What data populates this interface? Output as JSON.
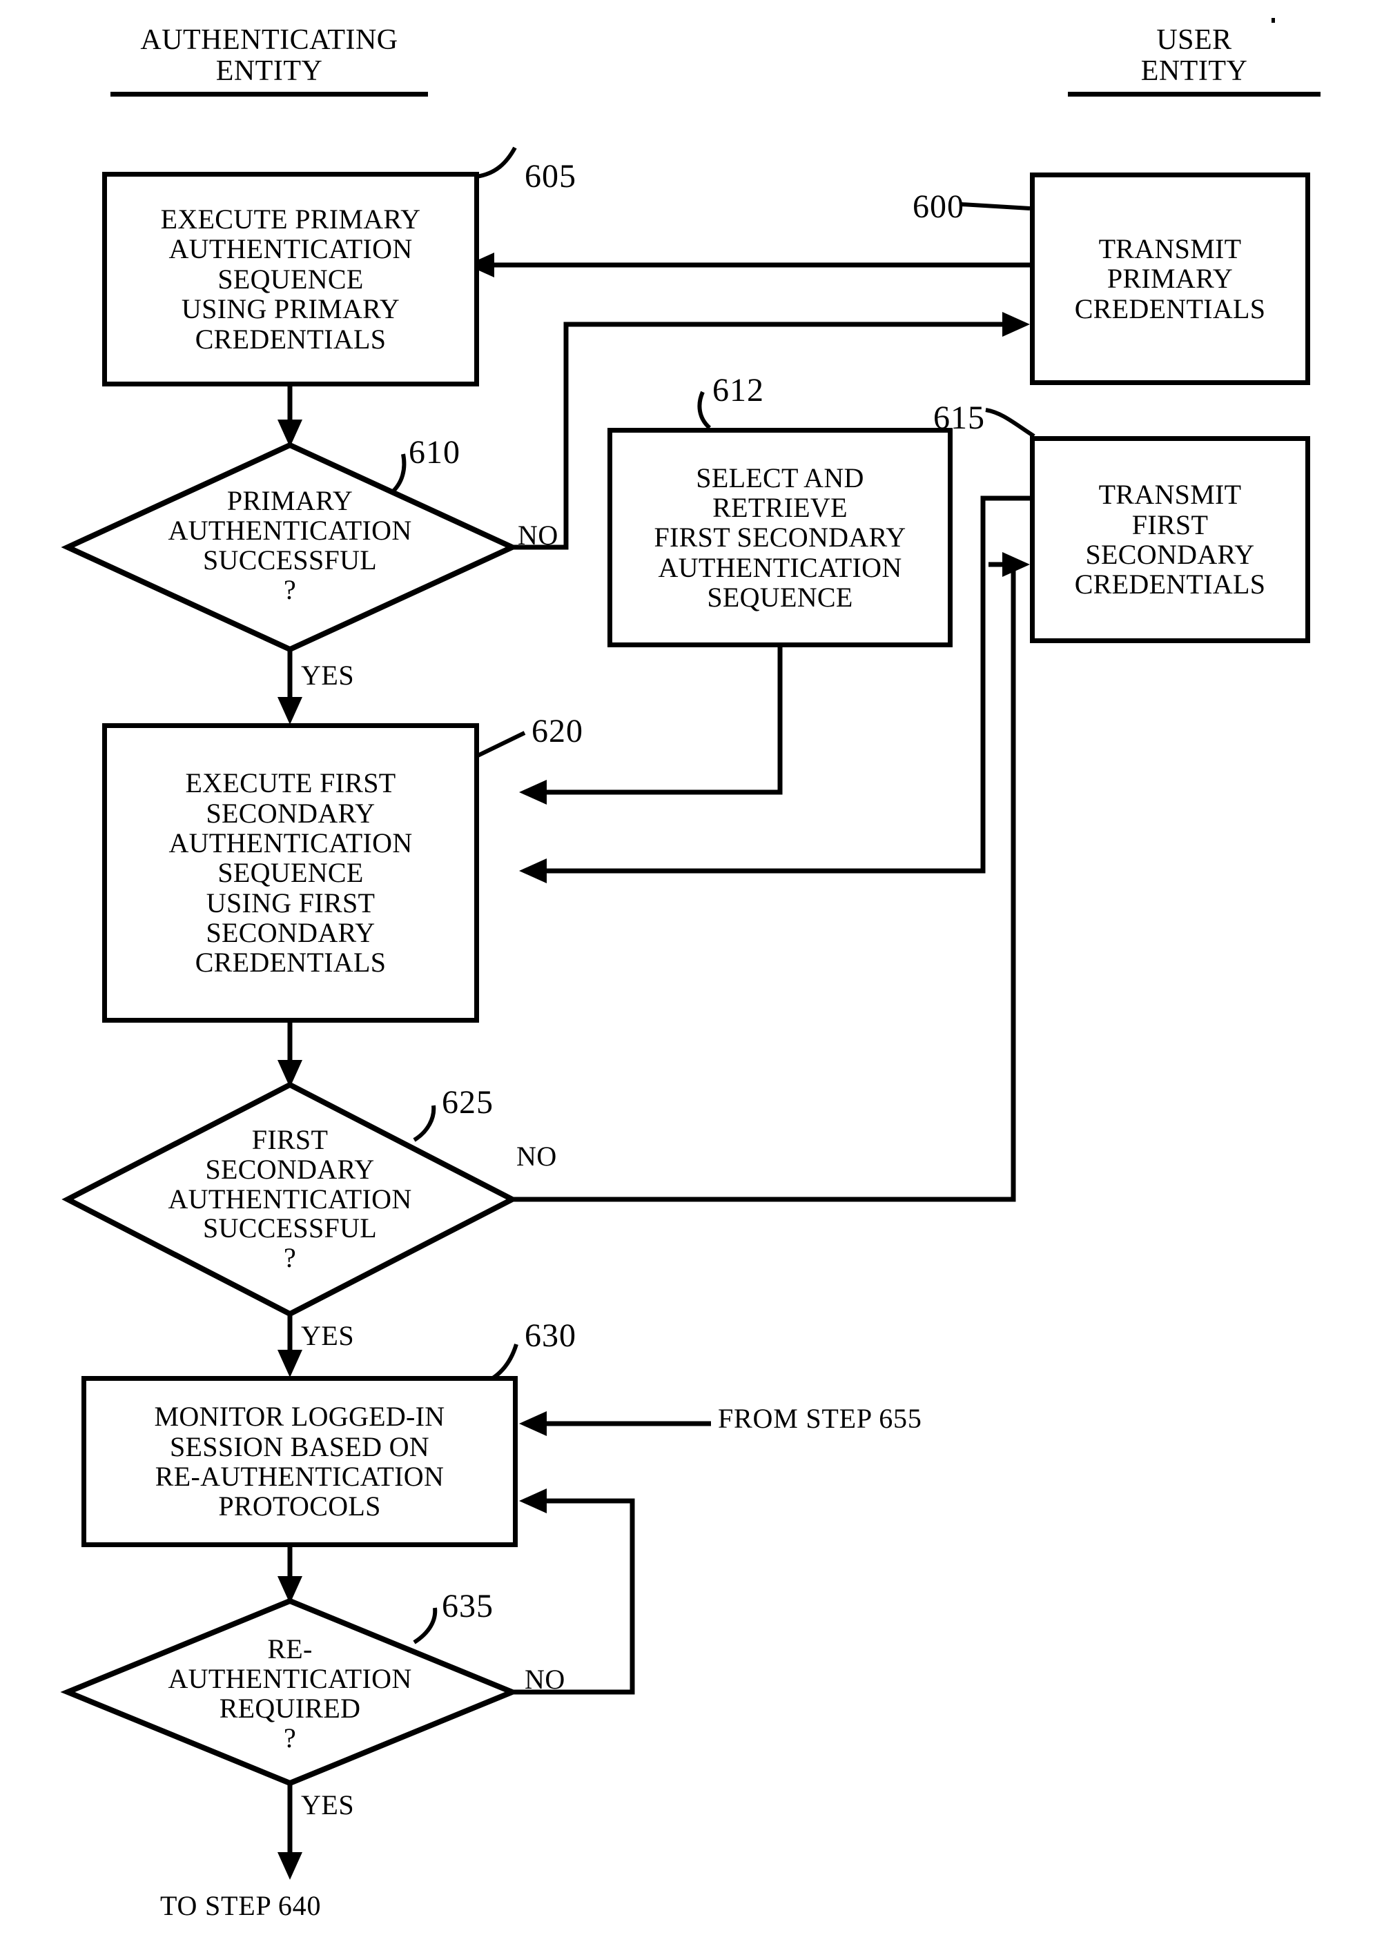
{
  "figure": {
    "type": "patent-flowchart",
    "columns": [
      {
        "id": "authenticating-entity",
        "title_line1": "AUTHENTICATING",
        "title_line2": "ENTITY"
      },
      {
        "id": "user-entity",
        "title_line1": "USER",
        "title_line2": "ENTITY"
      }
    ],
    "nodes": [
      {
        "ref": "600",
        "shape": "box",
        "column": "user-entity",
        "lines": [
          "TRANSMIT",
          "PRIMARY",
          "CREDENTIALS"
        ]
      },
      {
        "ref": "605",
        "shape": "box",
        "column": "authenticating-entity",
        "lines": [
          "EXECUTE PRIMARY",
          "AUTHENTICATION",
          "SEQUENCE",
          "USING PRIMARY",
          "CREDENTIALS"
        ]
      },
      {
        "ref": "610",
        "shape": "diamond",
        "column": "authenticating-entity",
        "lines": [
          "PRIMARY",
          "AUTHENTICATION",
          "SUCCESSFUL",
          "?"
        ]
      },
      {
        "ref": "612",
        "shape": "box",
        "column": "middle",
        "lines": [
          "SELECT AND",
          "RETRIEVE",
          "FIRST SECONDARY",
          "AUTHENTICATION",
          "SEQUENCE"
        ]
      },
      {
        "ref": "615",
        "shape": "box",
        "column": "user-entity",
        "lines": [
          "TRANSMIT",
          "FIRST",
          "SECONDARY",
          "CREDENTIALS"
        ]
      },
      {
        "ref": "620",
        "shape": "box",
        "column": "authenticating-entity",
        "lines": [
          "EXECUTE FIRST",
          "SECONDARY",
          "AUTHENTICATION",
          "SEQUENCE",
          "USING FIRST",
          "SECONDARY",
          "CREDENTIALS"
        ]
      },
      {
        "ref": "625",
        "shape": "diamond",
        "column": "authenticating-entity",
        "lines": [
          "FIRST",
          "SECONDARY",
          "AUTHENTICATION",
          "SUCCESSFUL",
          "?"
        ]
      },
      {
        "ref": "630",
        "shape": "box",
        "column": "authenticating-entity",
        "lines": [
          "MONITOR LOGGED-IN",
          "SESSION BASED ON",
          "RE-AUTHENTICATION",
          "PROTOCOLS"
        ]
      },
      {
        "ref": "635",
        "shape": "diamond",
        "column": "authenticating-entity",
        "lines": [
          "RE-",
          "AUTHENTICATION",
          "REQUIRED",
          "?"
        ]
      }
    ],
    "branch_labels": {
      "d610_no": "NO",
      "d610_yes": "YES",
      "d625_no": "NO",
      "d625_yes": "YES",
      "d635_no": "NO",
      "d635_yes": "YES"
    },
    "off_page_connectors": [
      {
        "id": "from-step-655",
        "text": "FROM STEP 655"
      },
      {
        "id": "to-step-640",
        "text": "TO  STEP 640"
      }
    ],
    "colors": {
      "ink": "#000000",
      "paper": "#ffffff"
    }
  }
}
